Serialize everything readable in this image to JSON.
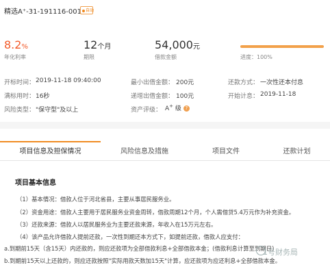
{
  "header": {
    "title": "精选A⁺-31-191116-001",
    "badge": "自动"
  },
  "stats": {
    "rate_value": "8.2",
    "rate_unit": "%",
    "rate_label": "年化利率",
    "term_value": "12",
    "term_unit": "个月",
    "term_label": "期限",
    "amount_value": "54,000",
    "amount_unit": "元",
    "amount_label": "借款金额",
    "progress_label": "进度：100%",
    "progress": 1.0,
    "progress_color": "#f2a14a"
  },
  "details": {
    "start_label": "开标时间：",
    "start_value": "2019-11-18 09:40:00",
    "min_label": "最小出借金额：",
    "min_value": "200元",
    "repay_label": "还款方式：",
    "repay_value": "一次性还本付息",
    "full_label": "满标用时：",
    "full_value": "16秒",
    "inc_label": "递增出借金额：",
    "inc_value": "100元",
    "interest_label": "开始计息：",
    "interest_value": "2019-11-18",
    "risk_label": "风险类型：",
    "risk_value": "\"保守型\"及以上",
    "grade_label": "资产评级：",
    "grade_value": "A",
    "grade_sup": "+",
    "grade_suffix": " 级",
    "help_icon_text": "?"
  },
  "tabs": [
    {
      "label": "项目信息及担保情况"
    },
    {
      "label": "风险信息及措施"
    },
    {
      "label": "项目文件"
    },
    {
      "label": "还款计划"
    }
  ],
  "section": {
    "title": "项目基本信息",
    "lines": [
      "（1）基本情况：借款人位于河北省县，主要从事居民服务业。",
      "（2）资金用途：借款人主要用于居民服务业资金周转，借款周期12个月，个人需借贷5.4万元作为补充资金。",
      "（3）还款来源：借款人以居民服务业为主要还款来源，年收入在15万元左右。",
      "（4）该产品允许借款人提前还款，一次性到期还本方式下，如提前还款，借款人应支付：",
      "a.到期前15天（含15天）内还款的，则应还款项为全部借款利息+全部借款本金；(借款利息计算至到期日)",
      "b.到期前15天以上还款的，则应还款按照\"实际用款天数加15天\"计算，应还款项为应还利息+全部借款本金。"
    ]
  },
  "watermark": "1号财务局"
}
